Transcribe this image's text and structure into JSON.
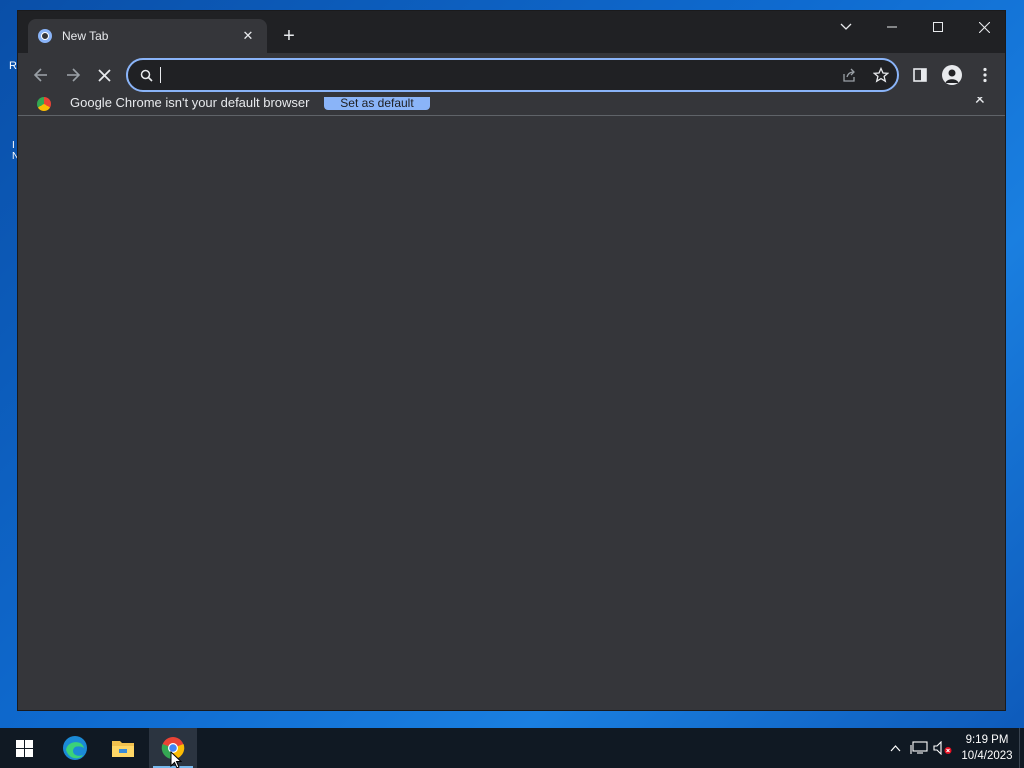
{
  "window": {
    "tab": {
      "title": "New Tab",
      "close_glyph": "✕"
    },
    "new_tab_glyph": "+",
    "controls": {
      "tab_search": "tab-search",
      "minimize": "minimize",
      "maximize": "maximize",
      "close": "close"
    }
  },
  "toolbar": {
    "omnibox": {
      "value": "",
      "placeholder": ""
    },
    "icons": [
      "back-arrow-icon",
      "forward-arrow-icon",
      "stop-loading-icon",
      "search-icon",
      "share-icon",
      "star-icon",
      "side-panel-icon",
      "profile-icon",
      "kebab-menu-icon"
    ]
  },
  "infobar": {
    "message": "Google Chrome isn't your default browser",
    "button_label": "Set as default",
    "close_glyph": "✕"
  },
  "taskbar": {
    "apps": [
      "windows-start-icon",
      "edge-icon",
      "file-explorer-icon",
      "chrome-icon"
    ],
    "clock": {
      "time": "9:19 PM",
      "date": "10/4/2023"
    }
  },
  "colors": {
    "chrome_dark": "#35363a",
    "titlebar": "#202124",
    "accent": "#8ab4f8",
    "taskbar": "#101923"
  }
}
